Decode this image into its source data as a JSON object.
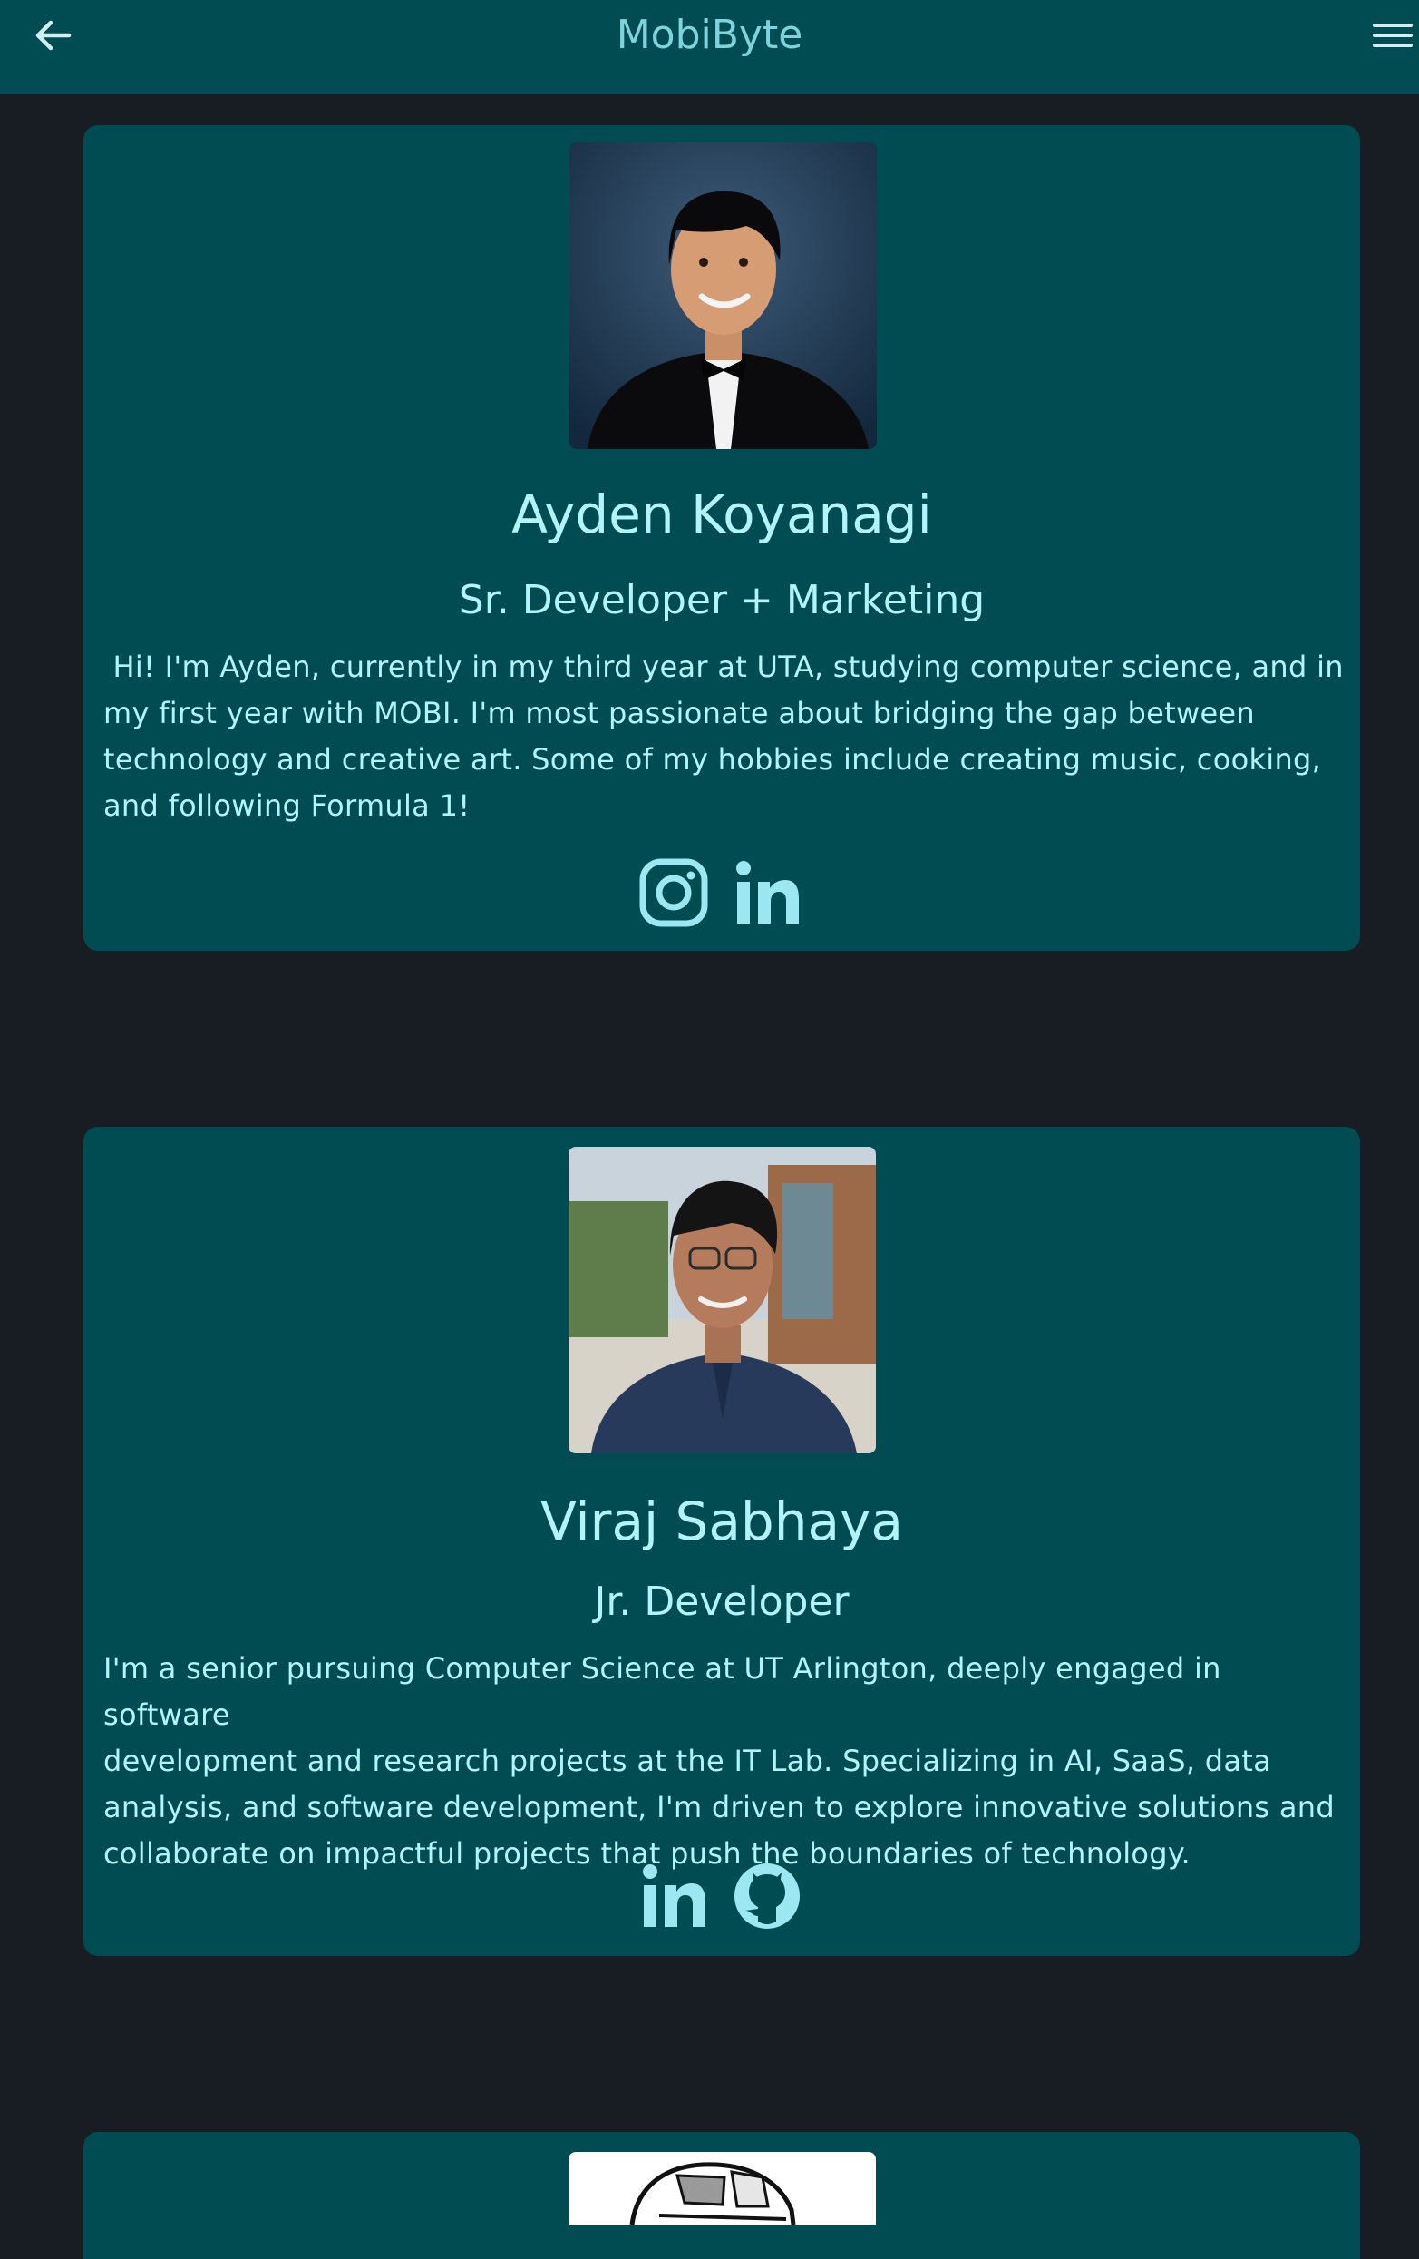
{
  "header": {
    "title": "MobiByte",
    "back_icon": "arrow-left-icon",
    "menu_icon": "hamburger-menu-icon"
  },
  "colors": {
    "header_bg": "#014b53",
    "page_bg": "#181c23",
    "card_bg": "#014b53",
    "text": "#b3f4f9",
    "title_text": "#7fd3dc"
  },
  "team": [
    {
      "name": "Ayden Koyanagi",
      "role": "Sr. Developer + Marketing",
      "bio": " Hi! I'm Ayden, currently in my third year at UTA, studying computer science, and in\nmy first year with MOBI. I'm most passionate about bridging the gap between\ntechnology and creative art. Some of my hobbies include creating music, cooking,\nand following Formula 1!",
      "socials": [
        "instagram-icon",
        "linkedin-icon"
      ]
    },
    {
      "name": "Viraj Sabhaya",
      "role": "Jr. Developer",
      "bio": "I'm a senior pursuing Computer Science at UT Arlington, deeply engaged in software\ndevelopment and research projects at the IT Lab. Specializing in AI, SaaS, data\nanalysis, and software development, I'm driven to explore innovative solutions and\ncollaborate on impactful projects that push the boundaries of technology.",
      "socials": [
        "linkedin-icon",
        "github-icon"
      ]
    }
  ]
}
